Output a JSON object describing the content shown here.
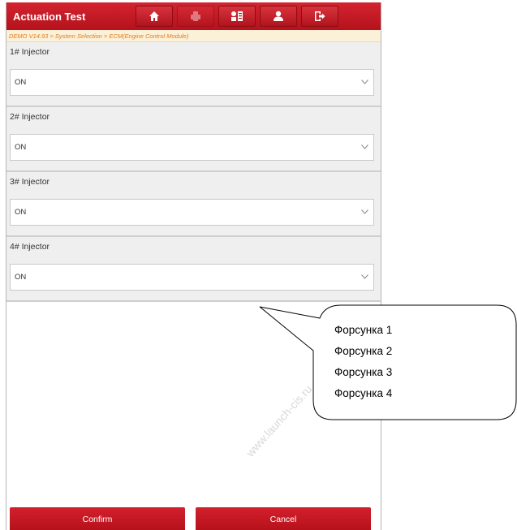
{
  "header": {
    "title": "Actuation Test",
    "icons": [
      "home-icon",
      "print-icon",
      "device-settings-icon",
      "user-icon",
      "exit-icon"
    ]
  },
  "breadcrumb": "DEMO V14.93 > System Selection > ECM(Engine Control Module)",
  "injectors": [
    {
      "label": "1# Injector",
      "value": "ON"
    },
    {
      "label": "2# Injector",
      "value": "ON"
    },
    {
      "label": "3# Injector",
      "value": "ON"
    },
    {
      "label": "4# Injector",
      "value": "ON"
    }
  ],
  "buttons": {
    "confirm": "Confirm",
    "cancel": "Cancel"
  },
  "callout": {
    "lines": [
      "Форсунка 1",
      "Форсунка 2",
      "Форсунка 3",
      "Форсунка 4"
    ]
  },
  "watermark": "www.launch-cis.ru",
  "colors": {
    "accent": "#c41a26",
    "breadcrumb_text": "#e27b23",
    "breadcrumb_bg": "#fbf0d8"
  }
}
